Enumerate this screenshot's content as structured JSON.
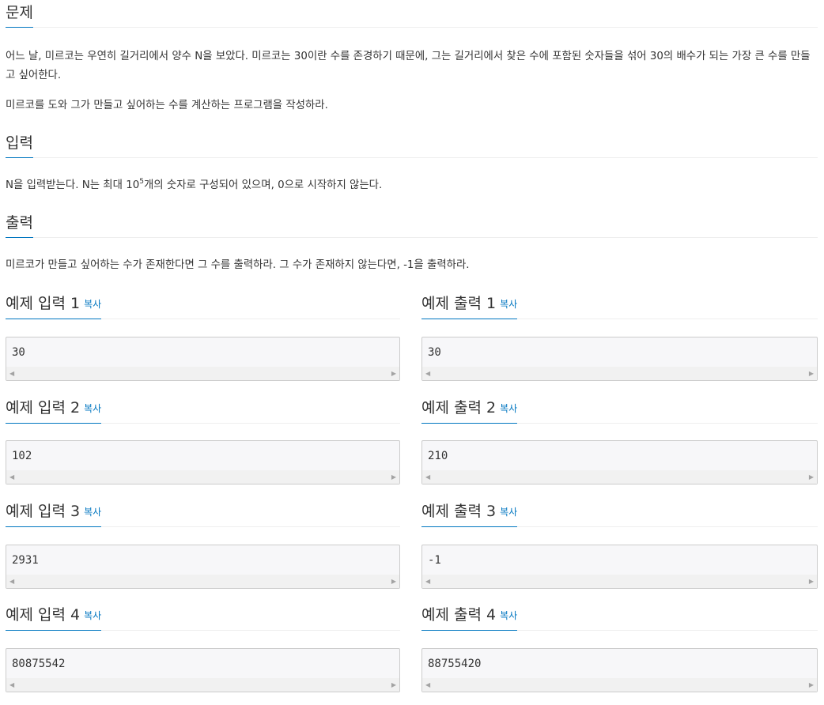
{
  "problem": {
    "title": "문제",
    "paragraphs": [
      "어느 날, 미르코는 우연히 길거리에서 양수 N을 보았다. 미르코는 30이란 수를 존경하기 때문에, 그는 길거리에서 찾은 수에 포함된 숫자들을 섞어 30의 배수가 되는 가장 큰 수를 만들고 싶어한다.",
      "미르코를 도와 그가 만들고 싶어하는 수를 계산하는 프로그램을 작성하라."
    ]
  },
  "input": {
    "title": "입력",
    "text_before": "N을 입력받는다. N는 최대 10",
    "sup": "5",
    "text_after": "개의 숫자로 구성되어 있으며, 0으로 시작하지 않는다."
  },
  "output": {
    "title": "출력",
    "text": "미르코가 만들고 싶어하는 수가 존재한다면 그 수를 출력하라. 그 수가 존재하지 않는다면, -1을 출력하라."
  },
  "copy_label": "복사",
  "examples": [
    {
      "input_title": "예제 입력 1",
      "input": "30",
      "output_title": "예제 출력 1",
      "output": "30"
    },
    {
      "input_title": "예제 입력 2",
      "input": "102",
      "output_title": "예제 출력 2",
      "output": "210"
    },
    {
      "input_title": "예제 입력 3",
      "input": "2931",
      "output_title": "예제 출력 3",
      "output": "-1"
    },
    {
      "input_title": "예제 입력 4",
      "input": "80875542",
      "output_title": "예제 출력 4",
      "output": "88755420"
    }
  ]
}
